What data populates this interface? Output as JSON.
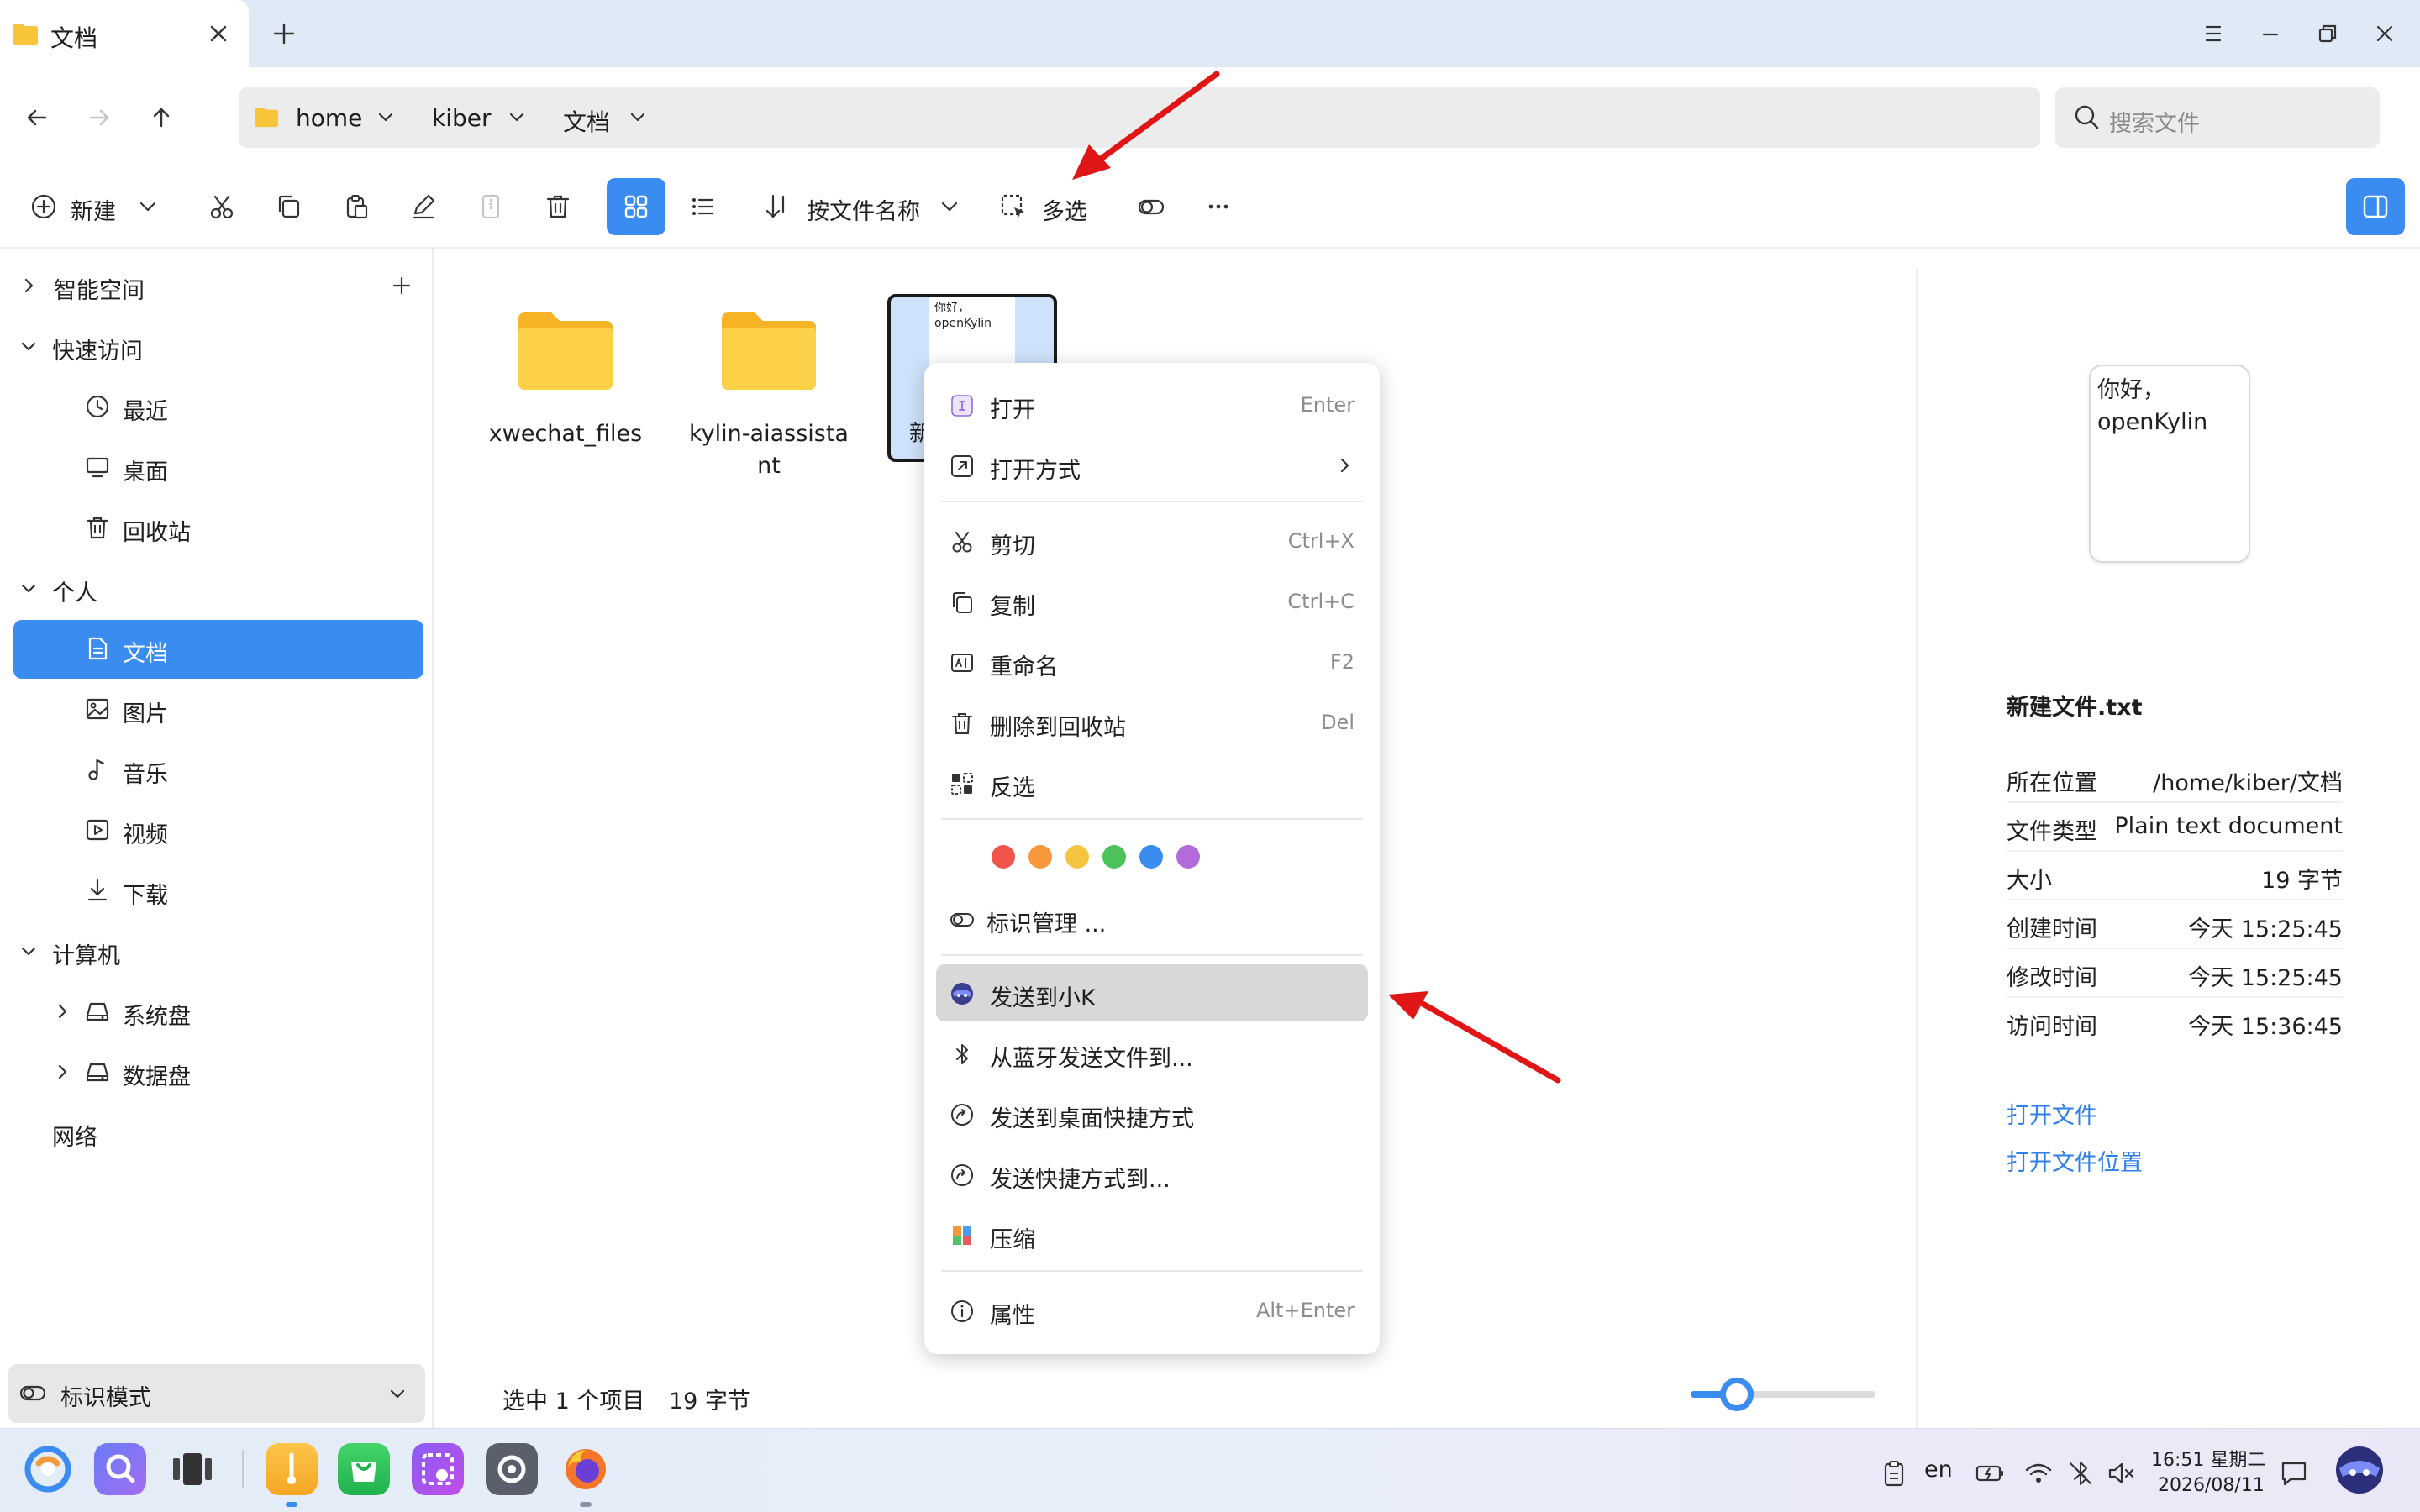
{
  "window": {
    "tab_title": "文档"
  },
  "navigation": {
    "breadcrumbs": [
      "home",
      "kiber",
      "文档"
    ],
    "search_placeholder": "搜索文件"
  },
  "toolbar": {
    "new_label": "新建",
    "sort_label": "按文件名称",
    "multiselect_label": "多选"
  },
  "sidebar": {
    "smart_space": "智能空间",
    "quick_access": "快速访问",
    "recent": "最近",
    "desktop": "桌面",
    "trash": "回收站",
    "personal": "个人",
    "documents": "文档",
    "pictures": "图片",
    "music": "音乐",
    "videos": "视频",
    "downloads": "下载",
    "computer": "计算机",
    "system_disk": "系统盘",
    "data_disk": "数据盘",
    "network": "网络",
    "mark_mode": "标识模式"
  },
  "files": [
    {
      "name": "xwechat_files",
      "type": "folder"
    },
    {
      "name": "kylin-aiassistant",
      "type": "folder"
    },
    {
      "name": "新",
      "type": "text",
      "preview_text": "你好，\nopenKylin"
    }
  ],
  "status": {
    "selected": "选中 1 个项目",
    "size": "19 字节",
    "zoom_level": 0.25
  },
  "context_menu": {
    "open": "打开",
    "open_sc": "Enter",
    "open_with": "打开方式",
    "cut": "剪切",
    "cut_sc": "Ctrl+X",
    "copy": "复制",
    "copy_sc": "Ctrl+C",
    "rename": "重命名",
    "rename_sc": "F2",
    "delete": "删除到回收站",
    "delete_sc": "Del",
    "invert": "反选",
    "tag_colors": [
      "#f0554b",
      "#f7983a",
      "#f5c542",
      "#4cc35a",
      "#3b8cf0",
      "#b36bd9"
    ],
    "tag_manage": "标识管理 ...",
    "send_to_k": "发送到小K",
    "bluetooth": "从蓝牙发送文件到...",
    "desktop_shortcut": "发送到桌面快捷方式",
    "send_shortcut": "发送快捷方式到...",
    "compress": "压缩",
    "properties": "属性",
    "properties_sc": "Alt+Enter"
  },
  "preview": {
    "thumb_text": "你好，\nopenKylin",
    "file_name": "新建文件.txt",
    "rows": [
      {
        "key": "所在位置",
        "value": "/home/kiber/文档"
      },
      {
        "key": "文件类型",
        "value": "Plain text document"
      },
      {
        "key": "大小",
        "value": "19 字节"
      },
      {
        "key": "创建时间",
        "value": "今天 15:25:45"
      },
      {
        "key": "修改时间",
        "value": "今天 15:25:45"
      },
      {
        "key": "访问时间",
        "value": "今天 15:36:45"
      }
    ],
    "open_file": "打开文件",
    "open_location": "打开文件位置"
  },
  "taskbar": {
    "lang": "en",
    "time": "16:51 星期二",
    "date": "2026/08/11"
  },
  "colors": {
    "accent": "#3b8cf0",
    "folder": "#f8c53a",
    "annotation_arrow": "#e01515"
  }
}
